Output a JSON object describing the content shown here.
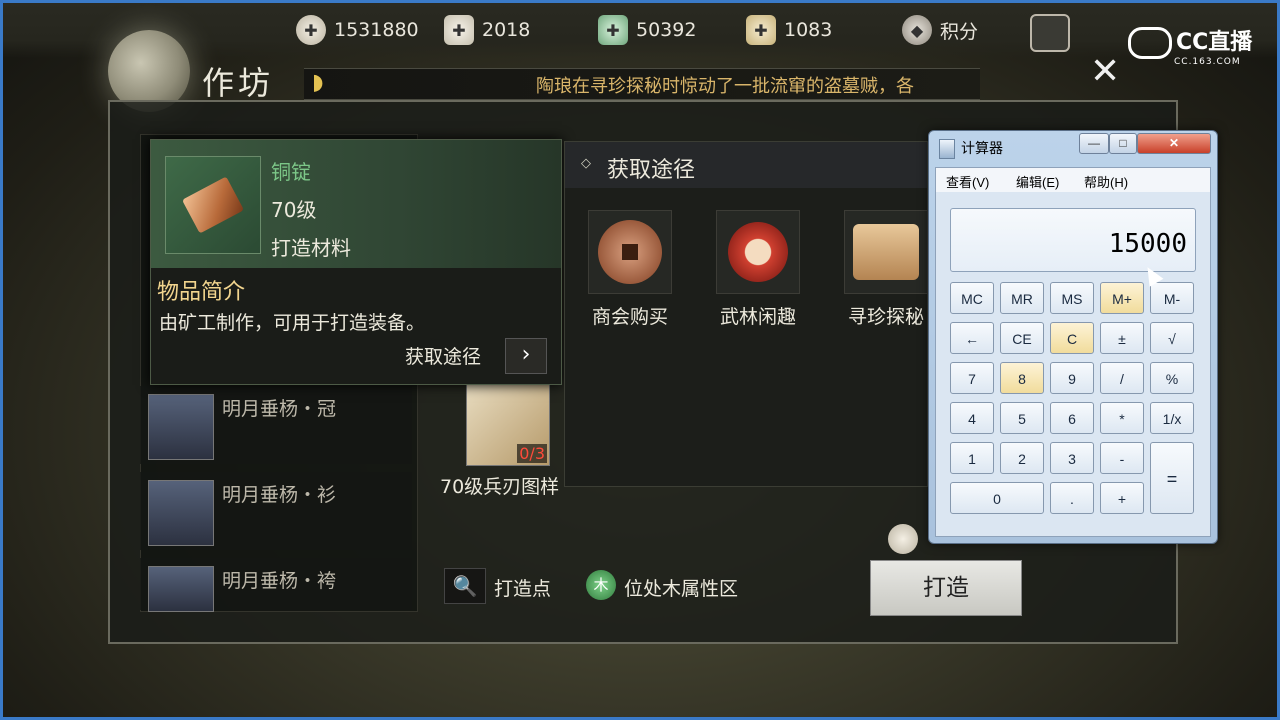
{
  "currency": [
    {
      "icon": "coin-icon",
      "value": "1531880"
    },
    {
      "icon": "silver-ingot-icon",
      "value": "2018"
    },
    {
      "icon": "jade-icon",
      "value": "50392"
    },
    {
      "icon": "gold-ingot-icon",
      "value": "1083"
    },
    {
      "icon": "badge-icon",
      "value": "积分"
    }
  ],
  "watermark": {
    "name": "CC直播",
    "sub": "CC.163.COM"
  },
  "workshop": {
    "title": "作坊",
    "news": "陶琅在寻珍探秘时惊动了一批流窜的盗墓贼，各",
    "close": "✕"
  },
  "equipment_list": [
    {
      "name": "明月垂杨・冠"
    },
    {
      "name": "明月垂杨・衫"
    },
    {
      "name": "明月垂杨・袴"
    }
  ],
  "tooltip": {
    "name": "铜锭",
    "level": "70级",
    "type": "打造材料",
    "section": "物品简介",
    "desc": "由矿工制作，可用于打造装备。",
    "link": "获取途径",
    "arrow": "›"
  },
  "acquire": {
    "title": "获取途径",
    "sources": [
      {
        "label": "商会购买"
      },
      {
        "label": "武林闲趣"
      },
      {
        "label": "寻珍探秘"
      }
    ]
  },
  "recipe": {
    "label": "70级兵刃图样",
    "count": "0/3"
  },
  "bottom": {
    "search_icon": "🔍",
    "forge_point": "打造点",
    "wood_badge": "木",
    "wood_label": "位处木属性区",
    "forge_button": "打造"
  },
  "calculator": {
    "title": "计算器",
    "menu": [
      "查看(V)",
      "编辑(E)",
      "帮助(H)"
    ],
    "display": "15000",
    "window_buttons": [
      "—",
      "□",
      "✕"
    ],
    "keys": [
      [
        "MC",
        "MR",
        "MS",
        "M+",
        "M-"
      ],
      [
        "←",
        "CE",
        "C",
        "±",
        "√"
      ],
      [
        "7",
        "8",
        "9",
        "/",
        "%"
      ],
      [
        "4",
        "5",
        "6",
        "*",
        "1/x"
      ],
      [
        "1",
        "2",
        "3",
        "-",
        "="
      ],
      [
        "0",
        ".",
        "+"
      ]
    ]
  }
}
